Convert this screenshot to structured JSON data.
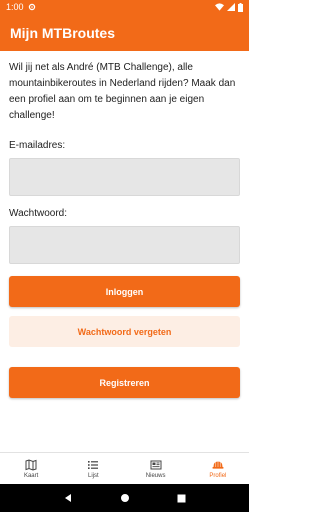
{
  "status_bar": {
    "time": "1:00"
  },
  "app_bar": {
    "title": "Mijn MTBroutes"
  },
  "intro_text": "Wil jij net als André (MTB Challenge), alle mountainbikeroutes in Nederland rijden? Maak dan een profiel aan om te beginnen aan je eigen challenge!",
  "form": {
    "email_label": "E-mailadres:",
    "email_value": "",
    "password_label": "Wachtwoord:",
    "password_value": ""
  },
  "buttons": {
    "login": "Inloggen",
    "forgot_password": "Wachtwoord vergeten",
    "register": "Registreren"
  },
  "bottom_nav": [
    {
      "label": "Kaart",
      "icon": "map-icon",
      "active": false
    },
    {
      "label": "Lijst",
      "icon": "list-icon",
      "active": false
    },
    {
      "label": "Nieuws",
      "icon": "newspaper-icon",
      "active": false
    },
    {
      "label": "Profiel",
      "icon": "helmet-icon",
      "active": true
    }
  ],
  "colors": {
    "accent": "#f26a18",
    "accent_light": "#fdeee4",
    "input_bg": "#e6e6e6"
  }
}
